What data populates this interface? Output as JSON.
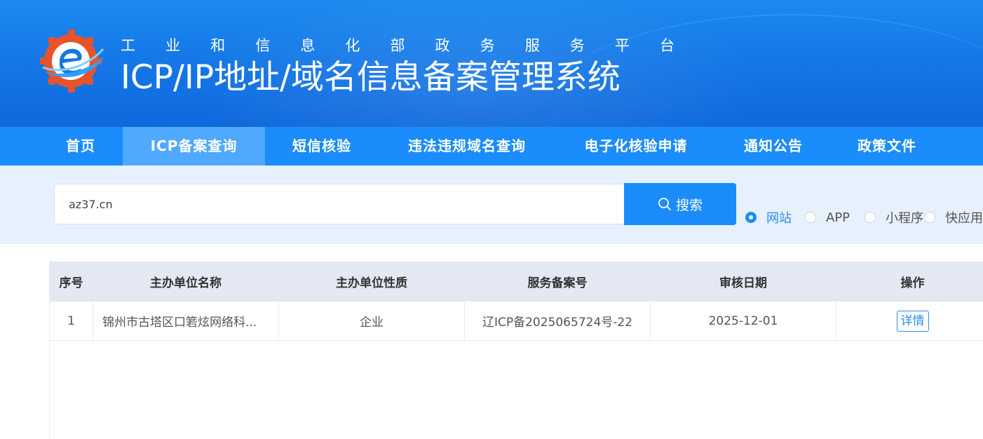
{
  "header": {
    "subtitle_chars": [
      "工",
      "业",
      "和",
      "信",
      "息",
      "化",
      "部",
      "政",
      "务",
      "服",
      "务",
      "平",
      "台"
    ],
    "title": "ICP/IP地址/域名信息备案管理系统"
  },
  "nav": {
    "items": [
      {
        "label": "首页",
        "active": false
      },
      {
        "label": "ICP备案查询",
        "active": true
      },
      {
        "label": "短信核验",
        "active": false
      },
      {
        "label": "违法违规域名查询",
        "active": false
      },
      {
        "label": "电子化核验申请",
        "active": false
      },
      {
        "label": "通知公告",
        "active": false
      },
      {
        "label": "政策文件",
        "active": false
      }
    ]
  },
  "search": {
    "value": "az37.cn",
    "button_label": "搜索",
    "button_icon": "search-icon",
    "types": [
      {
        "label": "网站",
        "checked": true
      },
      {
        "label": "APP",
        "checked": false
      },
      {
        "label": "小程序",
        "checked": false
      },
      {
        "label": "快应用",
        "checked": false
      }
    ]
  },
  "table": {
    "columns": [
      "序号",
      "主办单位名称",
      "主办单位性质",
      "服务备案号",
      "审核日期",
      "操作"
    ],
    "rows": [
      {
        "index": "1",
        "org_name": "锦州市古塔区口箬炫网络科...",
        "org_type": "企业",
        "record_no": "辽ICP备2025065724号-22",
        "date": "2025-12-01",
        "action": "详情"
      }
    ]
  },
  "colors": {
    "header_blue": "#1375e6",
    "nav_blue": "#1a8cfb",
    "nav_active": "#4fa9ff",
    "search_band": "#e6f1fd",
    "table_header": "#e3e8f2",
    "link_blue": "#2d8cf0",
    "logo_orange": "#e8532a"
  }
}
